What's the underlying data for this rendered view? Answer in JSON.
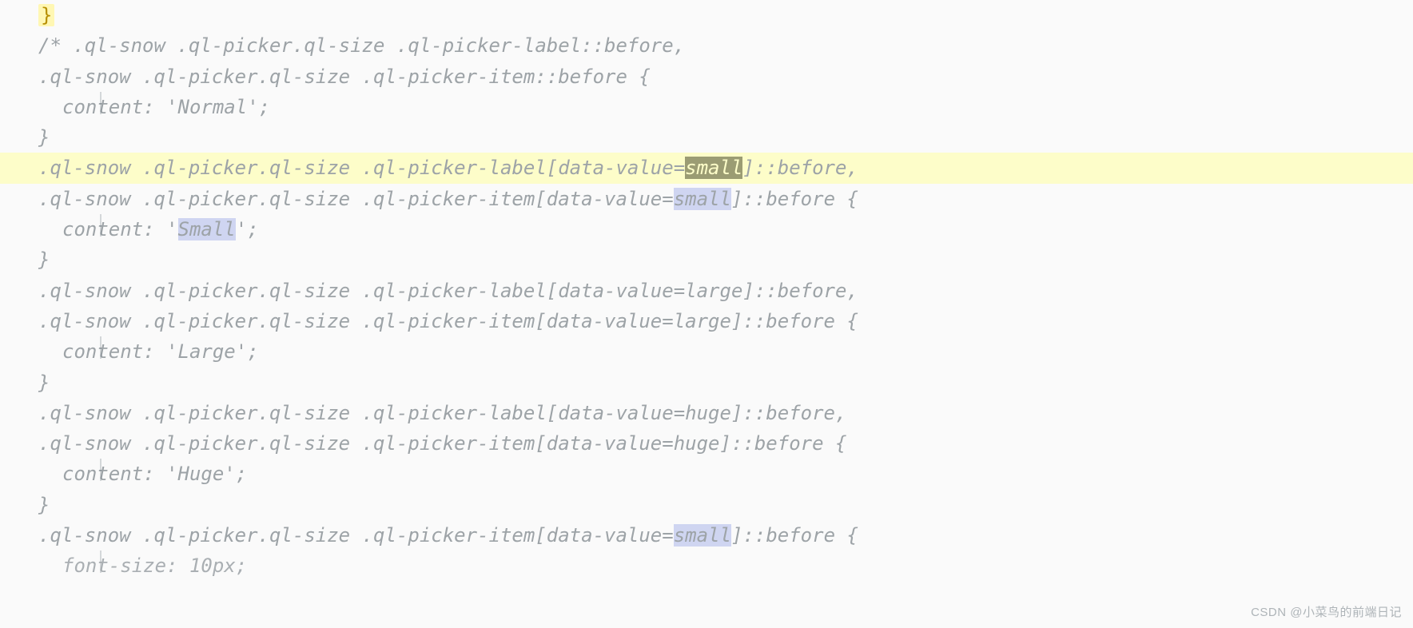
{
  "watermark": "CSDN @小菜鸟的前端日记",
  "tokens": {
    "brace": "}",
    "l01": "/* .ql-snow .ql-picker.ql-size .ql-picker-label::before,",
    "l02": ".ql-snow .ql-picker.ql-size .ql-picker-item::before {",
    "l03": "content: 'Normal';",
    "l04": "}",
    "l05a": ".ql-snow .ql-picker.ql-size .ql-picker-label[data-value=",
    "l05b": "small",
    "l05c": "]::before,",
    "l06a": ".ql-snow .ql-picker.ql-size .ql-picker-item[data-value=",
    "l06b": "small",
    "l06c": "]::before {",
    "l07a": "content: '",
    "l07b": "Small",
    "l07c": "';",
    "l08": "}",
    "l09": ".ql-snow .ql-picker.ql-size .ql-picker-label[data-value=large]::before,",
    "l10": ".ql-snow .ql-picker.ql-size .ql-picker-item[data-value=large]::before {",
    "l11": "content: 'Large';",
    "l12": "}",
    "l13": ".ql-snow .ql-picker.ql-size .ql-picker-label[data-value=huge]::before,",
    "l14": ".ql-snow .ql-picker.ql-size .ql-picker-item[data-value=huge]::before {",
    "l15": "content: 'Huge';",
    "l16": "}",
    "l17a": ".ql-snow .ql-picker.ql-size .ql-picker-item[data-value=",
    "l17b": "small",
    "l17c": "]::before {",
    "l18": "font-size: 10px;"
  }
}
